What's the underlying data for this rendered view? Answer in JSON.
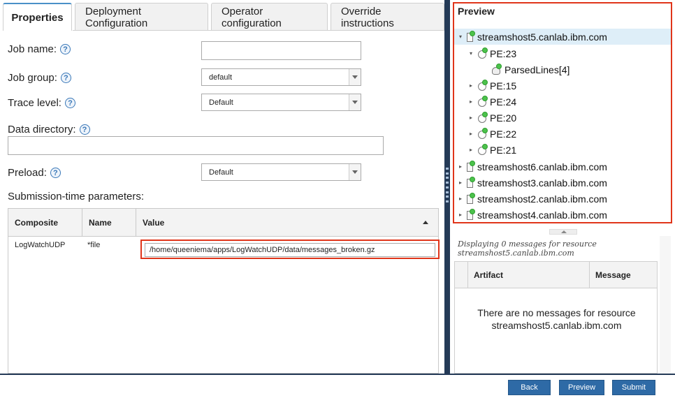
{
  "tabs": [
    {
      "label": "Properties",
      "active": true
    },
    {
      "label": "Deployment Configuration",
      "active": false
    },
    {
      "label": "Operator configuration",
      "active": false
    },
    {
      "label": "Override instructions",
      "active": false
    }
  ],
  "form": {
    "job_name": {
      "label": "Job name:",
      "value": ""
    },
    "job_group": {
      "label": "Job group:",
      "value": "default"
    },
    "trace_level": {
      "label": "Trace level:",
      "value": "Default"
    },
    "data_directory": {
      "label": "Data directory:",
      "value": ""
    },
    "preload": {
      "label": "Preload:",
      "value": "Default"
    },
    "help_glyph": "?"
  },
  "submission_params": {
    "title": "Submission-time parameters:",
    "columns": [
      "Composite",
      "Name",
      "Value"
    ],
    "rows": [
      {
        "composite": "LogWatchUDP",
        "name": "*file",
        "value": "/home/queeniema/apps/LogWatchUDP/data/messages_broken.gz"
      }
    ]
  },
  "preview": {
    "title": "Preview",
    "tree": [
      {
        "label": "streamshost5.canlab.ibm.com",
        "kind": "host",
        "twisty": "▾",
        "selected": true
      },
      {
        "label": "PE:23",
        "kind": "pe",
        "twisty": "▾"
      },
      {
        "label": "ParsedLines[4]",
        "kind": "operator",
        "twisty": ""
      },
      {
        "label": "PE:15",
        "kind": "pe",
        "twisty": "▸"
      },
      {
        "label": "PE:24",
        "kind": "pe",
        "twisty": "▸"
      },
      {
        "label": "PE:20",
        "kind": "pe",
        "twisty": "▸"
      },
      {
        "label": "PE:22",
        "kind": "pe",
        "twisty": "▸"
      },
      {
        "label": "PE:21",
        "kind": "pe",
        "twisty": "▸"
      },
      {
        "label": "streamshost6.canlab.ibm.com",
        "kind": "host",
        "twisty": "▸"
      },
      {
        "label": "streamshost3.canlab.ibm.com",
        "kind": "host",
        "twisty": "▸"
      },
      {
        "label": "streamshost2.canlab.ibm.com",
        "kind": "host",
        "twisty": "▸"
      },
      {
        "label": "streamshost4.canlab.ibm.com",
        "kind": "host",
        "twisty": "▸"
      }
    ]
  },
  "messages": {
    "caption": "Displaying 0 messages for resource streamshost5.canlab.ibm.com",
    "columns": [
      "Artifact",
      "Message"
    ],
    "empty_text": "There are no messages for resource streamshost5.canlab.ibm.com"
  },
  "footer": {
    "back_label": "Back",
    "preview_label": "Preview",
    "submit_label": "Submit"
  },
  "colors": {
    "accent": "#2e6aa6",
    "highlight_border": "#e0351a",
    "status_green": "#4cc24c",
    "selected_row": "#deeef8"
  }
}
